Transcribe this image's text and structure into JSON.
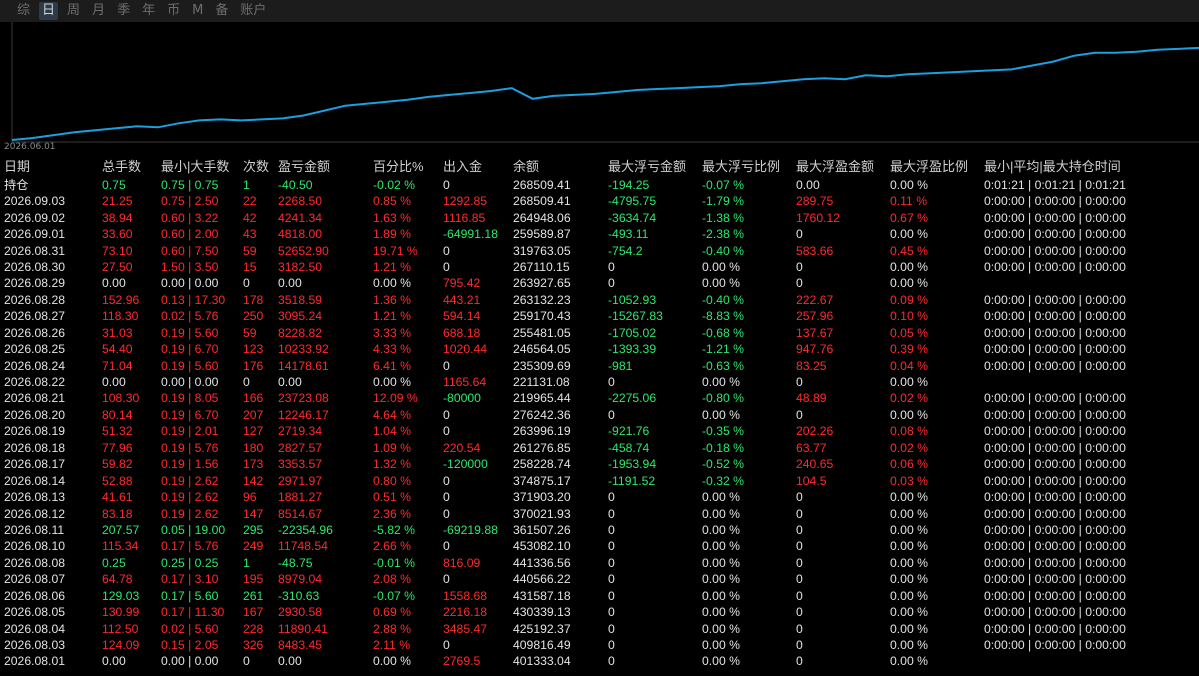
{
  "tabs": [
    "综",
    "日",
    "周",
    "月",
    "季",
    "年",
    "币",
    "M",
    "备",
    "账户"
  ],
  "active_tab": 1,
  "chart_data": {
    "type": "line",
    "start_label": "2026.06.01",
    "color": "#1aa0e0",
    "values": [
      0.0,
      0.02,
      0.05,
      0.08,
      0.1,
      0.12,
      0.14,
      0.13,
      0.17,
      0.2,
      0.21,
      0.2,
      0.21,
      0.22,
      0.25,
      0.3,
      0.35,
      0.37,
      0.39,
      0.41,
      0.44,
      0.46,
      0.48,
      0.5,
      0.53,
      0.42,
      0.45,
      0.46,
      0.47,
      0.49,
      0.51,
      0.52,
      0.53,
      0.54,
      0.55,
      0.57,
      0.58,
      0.6,
      0.62,
      0.63,
      0.62,
      0.66,
      0.65,
      0.67,
      0.68,
      0.69,
      0.7,
      0.71,
      0.72,
      0.76,
      0.8,
      0.86,
      0.89,
      0.89,
      0.9,
      0.92,
      0.93,
      0.94
    ]
  },
  "table": {
    "headers": [
      "日期",
      "总手数",
      "最小|大手数",
      "次数",
      "盈亏金额",
      "百分比%",
      "出入金",
      "余额",
      "最大浮亏金额",
      "最大浮亏比例",
      "最大浮盈金额",
      "最大浮盈比例",
      "最小|平均|最大持仓时间"
    ],
    "rows": [
      {
        "cells": [
          "持仓",
          "0.75",
          "0.75 | 0.75",
          "1",
          "-40.50",
          "-0.02 %",
          "0",
          "268509.41",
          "-194.25",
          "-0.07 %",
          "0.00",
          "0.00 %",
          "0:01:21 | 0:01:21 | 0:01:21"
        ],
        "tone": [
          "neu",
          "neg",
          "neg",
          "neg",
          "neg",
          "neg",
          "neu",
          "neu",
          "neg",
          "neg",
          "neu",
          "neu",
          "neu"
        ],
        "hold": true
      },
      {
        "cells": [
          "2026.09.03",
          "21.25",
          "0.75 | 2.50",
          "22",
          "2268.50",
          "0.85 %",
          "1292.85",
          "268509.41",
          "-4795.75",
          "-1.79 %",
          "289.75",
          "0.11 %",
          "0:00:00 | 0:00:00 | 0:00:00"
        ],
        "tone": [
          "neu",
          "pos",
          "pos",
          "pos",
          "pos",
          "pos",
          "pos",
          "neu",
          "neg",
          "neg",
          "pos",
          "pos",
          "neu"
        ]
      },
      {
        "cells": [
          "2026.09.02",
          "38.94",
          "0.60 | 3.22",
          "42",
          "4241.34",
          "1.63 %",
          "1116.85",
          "264948.06",
          "-3634.74",
          "-1.38 %",
          "1760.12",
          "0.67 %",
          "0:00:00 | 0:00:00 | 0:00:00"
        ],
        "tone": [
          "neu",
          "pos",
          "pos",
          "pos",
          "pos",
          "pos",
          "pos",
          "neu",
          "neg",
          "neg",
          "pos",
          "pos",
          "neu"
        ]
      },
      {
        "cells": [
          "2026.09.01",
          "33.60",
          "0.60 | 2.00",
          "43",
          "4818.00",
          "1.89 %",
          "-64991.18",
          "259589.87",
          "-493.11",
          "-2.38 %",
          "0",
          "0.00 %",
          "0:00:00 | 0:00:00 | 0:00:00"
        ],
        "tone": [
          "neu",
          "pos",
          "pos",
          "pos",
          "pos",
          "pos",
          "neg",
          "neu",
          "neg",
          "neg",
          "neu",
          "neu",
          "neu"
        ]
      },
      {
        "cells": [
          "2026.08.31",
          "73.10",
          "0.60 | 7.50",
          "59",
          "52652.90",
          "19.71 %",
          "0",
          "319763.05",
          "-754.2",
          "-0.40 %",
          "583.66",
          "0.45 %",
          "0:00:00 | 0:00:00 | 0:00:00"
        ],
        "tone": [
          "neu",
          "pos",
          "pos",
          "pos",
          "pos",
          "pos",
          "neu",
          "neu",
          "neg",
          "neg",
          "pos",
          "pos",
          "neu"
        ]
      },
      {
        "cells": [
          "2026.08.30",
          "27.50",
          "1.50 | 3.50",
          "15",
          "3182.50",
          "1.21 %",
          "0",
          "267110.15",
          "0",
          "0.00 %",
          "0",
          "0.00 %",
          "0:00:00 | 0:00:00 | 0:00:00"
        ],
        "tone": [
          "neu",
          "pos",
          "pos",
          "pos",
          "pos",
          "pos",
          "neu",
          "neu",
          "neu",
          "neu",
          "neu",
          "neu",
          "neu"
        ]
      },
      {
        "cells": [
          "2026.08.29",
          "0.00",
          "0.00 | 0.00",
          "0",
          "0.00",
          "0.00 %",
          "795.42",
          "263927.65",
          "0",
          "0.00 %",
          "0",
          "0.00 %",
          ""
        ],
        "tone": [
          "neu",
          "neu",
          "neu",
          "neu",
          "neu",
          "neu",
          "pos",
          "neu",
          "neu",
          "neu",
          "neu",
          "neu",
          "neu"
        ]
      },
      {
        "cells": [
          "2026.08.28",
          "152.96",
          "0.13 | 17.30",
          "178",
          "3518.59",
          "1.36 %",
          "443.21",
          "263132.23",
          "-1052.93",
          "-0.40 %",
          "222.67",
          "0.09 %",
          "0:00:00 | 0:00:00 | 0:00:00"
        ],
        "tone": [
          "neu",
          "pos",
          "pos",
          "pos",
          "pos",
          "pos",
          "pos",
          "neu",
          "neg",
          "neg",
          "pos",
          "pos",
          "neu"
        ]
      },
      {
        "cells": [
          "2026.08.27",
          "118.30",
          "0.02 | 5.76",
          "250",
          "3095.24",
          "1.21 %",
          "594.14",
          "259170.43",
          "-15267.83",
          "-8.83 %",
          "257.96",
          "0.10 %",
          "0:00:00 | 0:00:00 | 0:00:00"
        ],
        "tone": [
          "neu",
          "pos",
          "pos",
          "pos",
          "pos",
          "pos",
          "pos",
          "neu",
          "neg",
          "neg",
          "pos",
          "pos",
          "neu"
        ]
      },
      {
        "cells": [
          "2026.08.26",
          "31.03",
          "0.19 | 5.60",
          "59",
          "8228.82",
          "3.33 %",
          "688.18",
          "255481.05",
          "-1705.02",
          "-0.68 %",
          "137.67",
          "0.05 %",
          "0:00:00 | 0:00:00 | 0:00:00"
        ],
        "tone": [
          "neu",
          "pos",
          "pos",
          "pos",
          "pos",
          "pos",
          "pos",
          "neu",
          "neg",
          "neg",
          "pos",
          "pos",
          "neu"
        ]
      },
      {
        "cells": [
          "2026.08.25",
          "54.40",
          "0.19 | 6.70",
          "123",
          "10233.92",
          "4.33 %",
          "1020.44",
          "246564.05",
          "-1393.39",
          "-1.21 %",
          "947.76",
          "0.39 %",
          "0:00:00 | 0:00:00 | 0:00:00"
        ],
        "tone": [
          "neu",
          "pos",
          "pos",
          "pos",
          "pos",
          "pos",
          "pos",
          "neu",
          "neg",
          "neg",
          "pos",
          "pos",
          "neu"
        ]
      },
      {
        "cells": [
          "2026.08.24",
          "71.04",
          "0.19 | 5.60",
          "176",
          "14178.61",
          "6.41 %",
          "0",
          "235309.69",
          "-981",
          "-0.63 %",
          "83.25",
          "0.04 %",
          "0:00:00 | 0:00:00 | 0:00:00"
        ],
        "tone": [
          "neu",
          "pos",
          "pos",
          "pos",
          "pos",
          "pos",
          "neu",
          "neu",
          "neg",
          "neg",
          "pos",
          "pos",
          "neu"
        ]
      },
      {
        "cells": [
          "2026.08.22",
          "0.00",
          "0.00 | 0.00",
          "0",
          "0.00",
          "0.00 %",
          "1165.64",
          "221131.08",
          "0",
          "0.00 %",
          "0",
          "0.00 %",
          ""
        ],
        "tone": [
          "neu",
          "neu",
          "neu",
          "neu",
          "neu",
          "neu",
          "pos",
          "neu",
          "neu",
          "neu",
          "neu",
          "neu",
          "neu"
        ]
      },
      {
        "cells": [
          "2026.08.21",
          "108.30",
          "0.19 | 8.05",
          "166",
          "23723.08",
          "12.09 %",
          "-80000",
          "219965.44",
          "-2275.06",
          "-0.80 %",
          "48.89",
          "0.02 %",
          "0:00:00 | 0:00:00 | 0:00:00"
        ],
        "tone": [
          "neu",
          "pos",
          "pos",
          "pos",
          "pos",
          "pos",
          "neg",
          "neu",
          "neg",
          "neg",
          "pos",
          "pos",
          "neu"
        ]
      },
      {
        "cells": [
          "2026.08.20",
          "80.14",
          "0.19 | 6.70",
          "207",
          "12246.17",
          "4.64 %",
          "0",
          "276242.36",
          "0",
          "0.00 %",
          "0",
          "0.00 %",
          "0:00:00 | 0:00:00 | 0:00:00"
        ],
        "tone": [
          "neu",
          "pos",
          "pos",
          "pos",
          "pos",
          "pos",
          "neu",
          "neu",
          "neu",
          "neu",
          "neu",
          "neu",
          "neu"
        ]
      },
      {
        "cells": [
          "2026.08.19",
          "51.32",
          "0.19 | 2.01",
          "127",
          "2719.34",
          "1.04 %",
          "0",
          "263996.19",
          "-921.76",
          "-0.35 %",
          "202.26",
          "0.08 %",
          "0:00:00 | 0:00:00 | 0:00:00"
        ],
        "tone": [
          "neu",
          "pos",
          "pos",
          "pos",
          "pos",
          "pos",
          "neu",
          "neu",
          "neg",
          "neg",
          "pos",
          "pos",
          "neu"
        ]
      },
      {
        "cells": [
          "2026.08.18",
          "77.96",
          "0.19 | 5.76",
          "180",
          "2827.57",
          "1.09 %",
          "220.54",
          "261276.85",
          "-458.74",
          "-0.18 %",
          "63.77",
          "0.02 %",
          "0:00:00 | 0:00:00 | 0:00:00"
        ],
        "tone": [
          "neu",
          "pos",
          "pos",
          "pos",
          "pos",
          "pos",
          "pos",
          "neu",
          "neg",
          "neg",
          "pos",
          "pos",
          "neu"
        ]
      },
      {
        "cells": [
          "2026.08.17",
          "59.82",
          "0.19 | 1.56",
          "173",
          "3353.57",
          "1.32 %",
          "-120000",
          "258228.74",
          "-1953.94",
          "-0.52 %",
          "240.65",
          "0.06 %",
          "0:00:00 | 0:00:00 | 0:00:00"
        ],
        "tone": [
          "neu",
          "pos",
          "pos",
          "pos",
          "pos",
          "pos",
          "neg",
          "neu",
          "neg",
          "neg",
          "pos",
          "pos",
          "neu"
        ]
      },
      {
        "cells": [
          "2026.08.14",
          "52.88",
          "0.19 | 2.62",
          "142",
          "2971.97",
          "0.80 %",
          "0",
          "374875.17",
          "-1191.52",
          "-0.32 %",
          "104.5",
          "0.03 %",
          "0:00:00 | 0:00:00 | 0:00:00"
        ],
        "tone": [
          "neu",
          "pos",
          "pos",
          "pos",
          "pos",
          "pos",
          "neu",
          "neu",
          "neg",
          "neg",
          "pos",
          "pos",
          "neu"
        ]
      },
      {
        "cells": [
          "2026.08.13",
          "41.61",
          "0.19 | 2.62",
          "96",
          "1881.27",
          "0.51 %",
          "0",
          "371903.20",
          "0",
          "0.00 %",
          "0",
          "0.00 %",
          "0:00:00 | 0:00:00 | 0:00:00"
        ],
        "tone": [
          "neu",
          "pos",
          "pos",
          "pos",
          "pos",
          "pos",
          "neu",
          "neu",
          "neu",
          "neu",
          "neu",
          "neu",
          "neu"
        ]
      },
      {
        "cells": [
          "2026.08.12",
          "83.18",
          "0.19 | 2.62",
          "147",
          "8514.67",
          "2.36 %",
          "0",
          "370021.93",
          "0",
          "0.00 %",
          "0",
          "0.00 %",
          "0:00:00 | 0:00:00 | 0:00:00"
        ],
        "tone": [
          "neu",
          "pos",
          "pos",
          "pos",
          "pos",
          "pos",
          "neu",
          "neu",
          "neu",
          "neu",
          "neu",
          "neu",
          "neu"
        ]
      },
      {
        "cells": [
          "2026.08.11",
          "207.57",
          "0.05 | 19.00",
          "295",
          "-22354.96",
          "-5.82 %",
          "-69219.88",
          "361507.26",
          "0",
          "0.00 %",
          "0",
          "0.00 %",
          "0:00:00 | 0:00:00 | 0:00:00"
        ],
        "tone": [
          "neu",
          "neg",
          "neg",
          "neg",
          "neg",
          "neg",
          "neg",
          "neu",
          "neu",
          "neu",
          "neu",
          "neu",
          "neu"
        ]
      },
      {
        "cells": [
          "2026.08.10",
          "115.34",
          "0.17 | 5.76",
          "249",
          "11748.54",
          "2.66 %",
          "0",
          "453082.10",
          "0",
          "0.00 %",
          "0",
          "0.00 %",
          "0:00:00 | 0:00:00 | 0:00:00"
        ],
        "tone": [
          "neu",
          "pos",
          "pos",
          "pos",
          "pos",
          "pos",
          "neu",
          "neu",
          "neu",
          "neu",
          "neu",
          "neu",
          "neu"
        ]
      },
      {
        "cells": [
          "2026.08.08",
          "0.25",
          "0.25 | 0.25",
          "1",
          "-48.75",
          "-0.01 %",
          "816.09",
          "441336.56",
          "0",
          "0.00 %",
          "0",
          "0.00 %",
          "0:00:00 | 0:00:00 | 0:00:00"
        ],
        "tone": [
          "neu",
          "neg",
          "neg",
          "neg",
          "neg",
          "neg",
          "pos",
          "neu",
          "neu",
          "neu",
          "neu",
          "neu",
          "neu"
        ]
      },
      {
        "cells": [
          "2026.08.07",
          "64.78",
          "0.17 | 3.10",
          "195",
          "8979.04",
          "2.08 %",
          "0",
          "440566.22",
          "0",
          "0.00 %",
          "0",
          "0.00 %",
          "0:00:00 | 0:00:00 | 0:00:00"
        ],
        "tone": [
          "neu",
          "pos",
          "pos",
          "pos",
          "pos",
          "pos",
          "neu",
          "neu",
          "neu",
          "neu",
          "neu",
          "neu",
          "neu"
        ]
      },
      {
        "cells": [
          "2026.08.06",
          "129.03",
          "0.17 | 5.60",
          "261",
          "-310.63",
          "-0.07 %",
          "1558.68",
          "431587.18",
          "0",
          "0.00 %",
          "0",
          "0.00 %",
          "0:00:00 | 0:00:00 | 0:00:00"
        ],
        "tone": [
          "neu",
          "neg",
          "neg",
          "neg",
          "neg",
          "neg",
          "pos",
          "neu",
          "neu",
          "neu",
          "neu",
          "neu",
          "neu"
        ]
      },
      {
        "cells": [
          "2026.08.05",
          "130.99",
          "0.17 | 11.30",
          "167",
          "2930.58",
          "0.69 %",
          "2216.18",
          "430339.13",
          "0",
          "0.00 %",
          "0",
          "0.00 %",
          "0:00:00 | 0:00:00 | 0:00:00"
        ],
        "tone": [
          "neu",
          "pos",
          "pos",
          "pos",
          "pos",
          "pos",
          "pos",
          "neu",
          "neu",
          "neu",
          "neu",
          "neu",
          "neu"
        ]
      },
      {
        "cells": [
          "2026.08.04",
          "112.50",
          "0.02 | 5.60",
          "228",
          "11890.41",
          "2.88 %",
          "3485.47",
          "425192.37",
          "0",
          "0.00 %",
          "0",
          "0.00 %",
          "0:00:00 | 0:00:00 | 0:00:00"
        ],
        "tone": [
          "neu",
          "pos",
          "pos",
          "pos",
          "pos",
          "pos",
          "pos",
          "neu",
          "neu",
          "neu",
          "neu",
          "neu",
          "neu"
        ]
      },
      {
        "cells": [
          "2026.08.03",
          "124.09",
          "0.15 | 2.05",
          "326",
          "8483.45",
          "2.11 %",
          "0",
          "409816.49",
          "0",
          "0.00 %",
          "0",
          "0.00 %",
          "0:00:00 | 0:00:00 | 0:00:00"
        ],
        "tone": [
          "neu",
          "pos",
          "pos",
          "pos",
          "pos",
          "pos",
          "neu",
          "neu",
          "neu",
          "neu",
          "neu",
          "neu",
          "neu"
        ]
      },
      {
        "cells": [
          "2026.08.01",
          "0.00",
          "0.00 | 0.00",
          "0",
          "0.00",
          "0.00 %",
          "2769.5",
          "401333.04",
          "0",
          "0.00 %",
          "0",
          "0.00 %",
          ""
        ],
        "tone": [
          "neu",
          "neu",
          "neu",
          "neu",
          "neu",
          "neu",
          "pos",
          "neu",
          "neu",
          "neu",
          "neu",
          "neu",
          "neu"
        ]
      }
    ]
  }
}
